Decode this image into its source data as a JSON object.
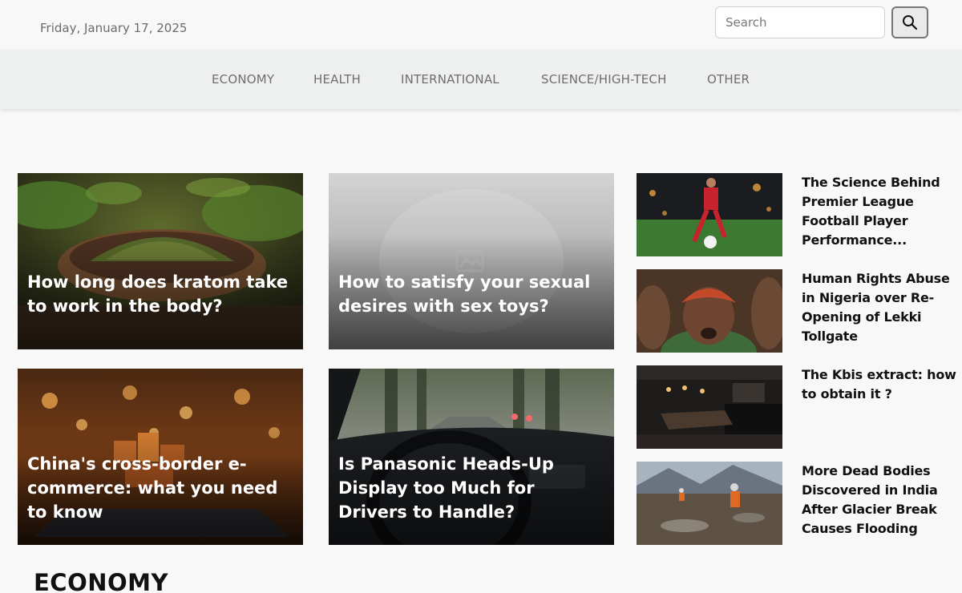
{
  "header": {
    "date": "Friday, January 17, 2025",
    "search_placeholder": "Search",
    "search_value": ""
  },
  "nav": {
    "items": [
      "ECONOMY",
      "HEALTH",
      "INTERNATIONAL",
      "SCIENCE/HIGH-TECH",
      "OTHER"
    ]
  },
  "featured": [
    {
      "title": "How long does kratom take to work in the body?",
      "image": "kratom-powder-bowl"
    },
    {
      "title": "How to satisfy your sexual desires with sex toys?",
      "image": "placeholder-image"
    },
    {
      "title": "China's cross-border e-commerce: what you need to know",
      "image": "laptop-gift-boxes"
    },
    {
      "title": "Is Panasonic Heads-Up Display too Much for Drivers to Handle?",
      "image": "car-dashboard-road"
    }
  ],
  "sidebar": {
    "items": [
      {
        "title": "The Science Behind Premier League Football Player Performance...",
        "image": "football-player"
      },
      {
        "title": "Human Rights Abuse in Nigeria over Re-Opening of Lekki Tollgate",
        "image": "protester"
      },
      {
        "title": "The Kbis extract: how to obtain it ?",
        "image": "dark-kitchen"
      },
      {
        "title": "More Dead Bodies Discovered in India After Glacier Break Causes Flooding",
        "image": "rescue-workers-mud"
      }
    ]
  },
  "sections": {
    "economy_heading": "ECONOMY"
  },
  "colors": {
    "page_background": "#f8f8f8",
    "nav_background": "#eef0ef",
    "nav_text": "#6e6e6e",
    "headline_text": "#111111",
    "overlay_text": "#ffffff"
  }
}
